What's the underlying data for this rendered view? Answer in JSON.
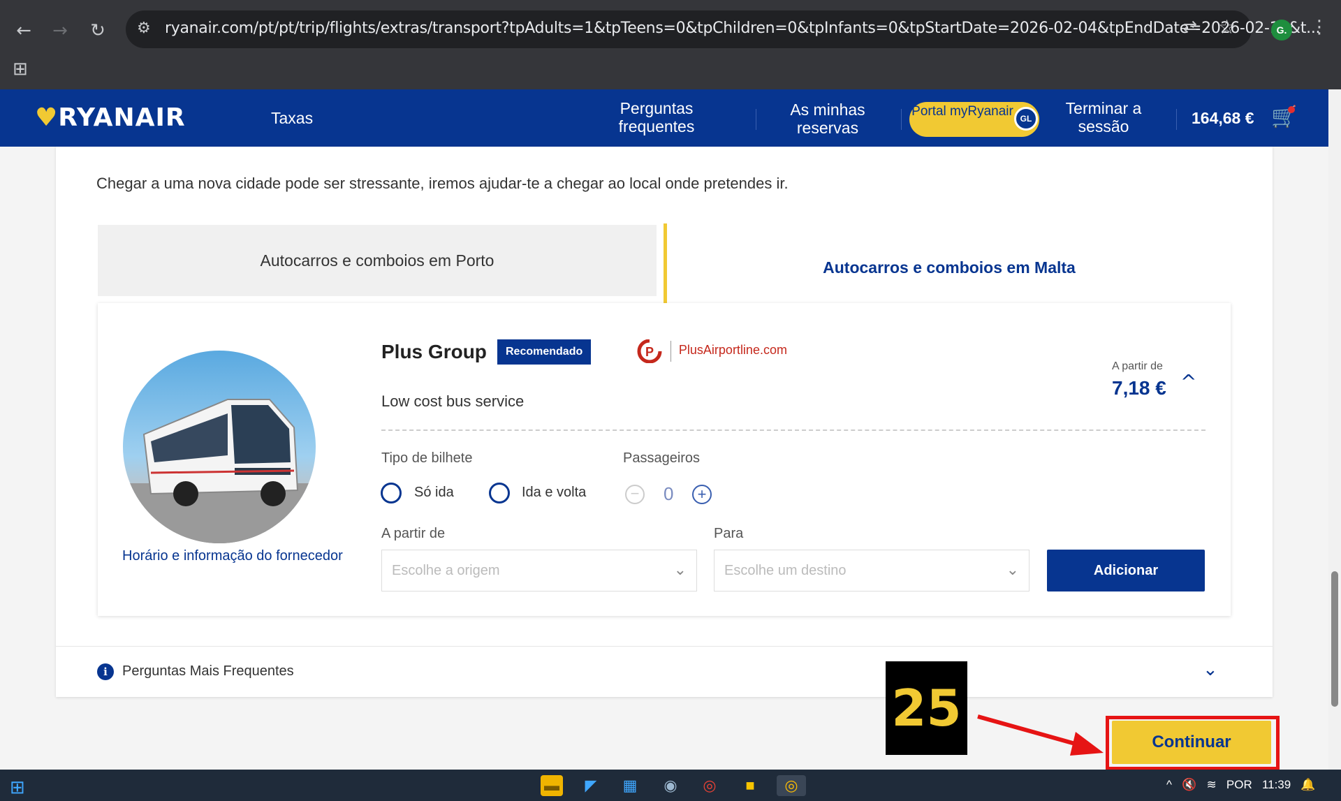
{
  "browser": {
    "url": "ryanair.com/pt/pt/trip/flights/extras/transport?tpAdults=1&tpTeens=0&tpChildren=0&tpInfants=0&tpStartDate=2026-02-04&tpEndDate=2026-02-18&t...",
    "profile_initial": "G."
  },
  "header": {
    "logo": "RYANAIR",
    "taxas": "Taxas",
    "faq": "Perguntas frequentes",
    "reservations": "As minhas reservas",
    "portal": "Portal myRyanair",
    "portal_badge": "GL",
    "logout": "Terminar a sessão",
    "total": "164,68 €"
  },
  "main": {
    "intro": "Chegar a uma nova cidade pode ser stressante, iremos ajudar-te a chegar ao local onde pretendes ir.",
    "tabs": [
      {
        "label": "Autocarros e comboios em Porto",
        "active": false
      },
      {
        "label": "Autocarros e comboios em Malta",
        "active": true
      }
    ],
    "provider": {
      "name": "Plus Group",
      "badge": "Recomendado",
      "logo_text": "PlusAirportline.com",
      "description": "Low cost bus service",
      "price_prefix": "A partir de",
      "price": "7,18 €",
      "schedule_link": "Horário e informação do fornecedor"
    },
    "form": {
      "ticket_type_label": "Tipo de bilhete",
      "one_way": "Só ida",
      "round_trip": "Ida e volta",
      "passengers_label": "Passageiros",
      "passengers": "0",
      "from_label": "A partir de",
      "from_placeholder": "Escolhe a origem",
      "to_label": "Para",
      "to_placeholder": "Escolhe um destino",
      "add_button": "Adicionar"
    },
    "faq_section": "Perguntas Mais Frequentes",
    "continue_button": "Continuar",
    "step_marker": "25"
  },
  "taskbar": {
    "language": "POR",
    "time": "11:39"
  },
  "colors": {
    "brand_blue": "#073590",
    "brand_yellow": "#f1c933",
    "annotation_red": "#e61414"
  }
}
